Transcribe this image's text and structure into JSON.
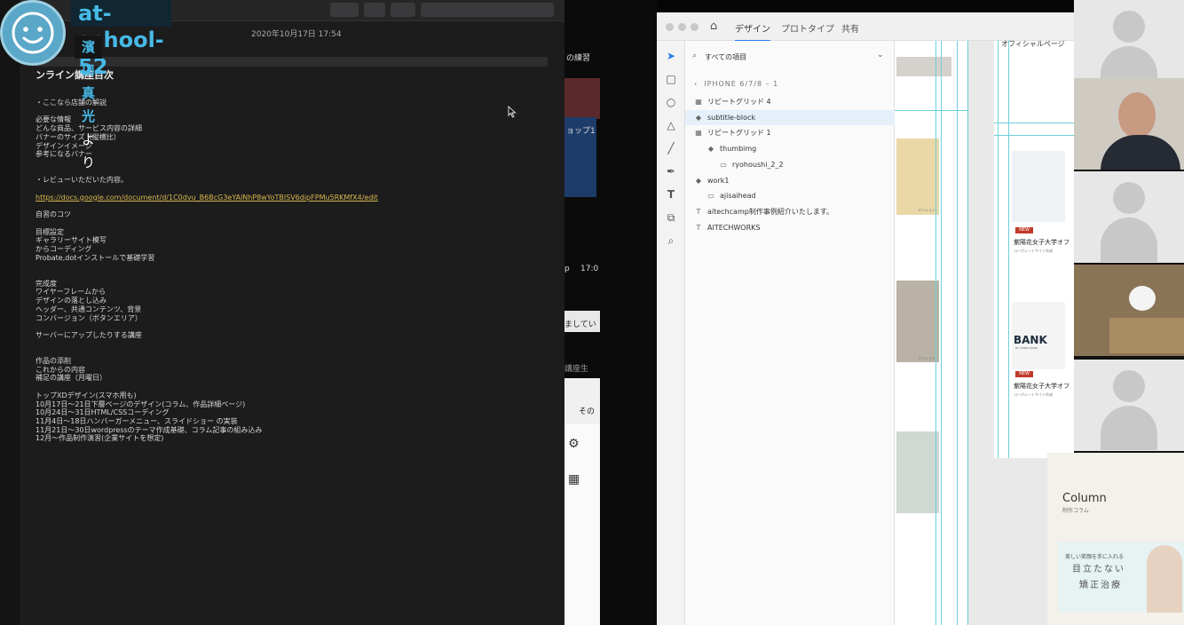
{
  "overlay": {
    "username": "at-school-52",
    "sender_name": "濱口 真光",
    "sender_suffix": "より"
  },
  "note": {
    "timestamp": "2020年10月17日 17:54",
    "heading": "ンライン講座目次",
    "lines": [
      "・ここなら店舗の解説",
      "",
      "必要な情報",
      "どんな商品、サービス内容の詳細",
      "バナーのサイズ（縦横比）",
      "デザインイメージ",
      "参考になるバナー",
      "",
      "",
      "・レビューいただいた内容。",
      "",
      "https://docs.google.com/document/d/1C0dvu_B6BcG3eYAlNhP8wYoTBlSV6dipFPMu5RKMfX4/edit",
      "",
      "自習のコツ",
      "",
      "目標設定",
      "ギャラリーサイト模写",
      "からコーディング",
      "Probate,dotインストールで基礎学習",
      "",
      "",
      "完成度",
      "ワイヤーフレームから",
      "デザインの落とし込み",
      "ヘッダー、共通コンテンツ、背景",
      "コンバージョン（ボタンエリア）",
      "",
      "サーバーにアップしたりする講座",
      "",
      "",
      "作品の添削",
      "これからの内容",
      "補足の講座（月曜日）",
      "",
      "トップXDデザイン(スマホ用も)",
      "10月17日〜21日下層ページのデザイン(コラム、作品詳細ページ)",
      "10月24日〜31日HTML/CSSコーディング",
      "11月4日〜18日ハンバーガーメニュー、スライドショー の実装",
      "11月21日〜30日wordpressのテーマ作成基礎、コラム記事の組み込み",
      "12月〜作品制作演習(企業サイトを想定)"
    ]
  },
  "midgap": {
    "texts": [
      "の練習",
      "ョップ1",
      "17:0",
      "p",
      "ましてい",
      "講座生",
      "その"
    ]
  },
  "xd": {
    "tabs": [
      "デザイン",
      "プロトタイプ",
      "共有"
    ],
    "search_placeholder": "すべての項目",
    "breadcrumb": "IPHONE 6/7/8 – 1",
    "layers": [
      {
        "label": "リピートグリッド 4",
        "icon": "grid-icon",
        "glyph": "▦",
        "indent": 0,
        "selected": false
      },
      {
        "label": "subtitle-block",
        "icon": "component-icon",
        "glyph": "◆",
        "indent": 0,
        "selected": true
      },
      {
        "label": "リピートグリッド 1",
        "icon": "grid-icon",
        "glyph": "▦",
        "indent": 0,
        "selected": false
      },
      {
        "label": "thumbimg",
        "icon": "component-icon",
        "glyph": "◆",
        "indent": 1,
        "selected": false
      },
      {
        "label": "ryohoushi_2_2",
        "icon": "image-icon",
        "glyph": "▭",
        "indent": 2,
        "selected": false
      },
      {
        "label": "work1",
        "icon": "component-icon",
        "glyph": "◆",
        "indent": 0,
        "selected": false
      },
      {
        "label": "ajisaihead",
        "icon": "image-icon",
        "glyph": "▭",
        "indent": 1,
        "selected": false
      },
      {
        "label": "aitechcamp制作事例紹介いたします。",
        "icon": "text-icon",
        "glyph": "T",
        "indent": 0,
        "selected": false
      },
      {
        "label": "AITECHWORKS",
        "icon": "text-icon",
        "glyph": "T",
        "indent": 0,
        "selected": false
      }
    ],
    "canvas": {
      "page_title": "オフィシャルページ",
      "new_badge": "NEW",
      "card_title": "紫陽花女子大学オフ",
      "card_sub": "コーポレートサイト作成",
      "bank_logo": "BANK",
      "bank_sub": "BY ASIBKA BANK",
      "tag1": "マンション",
      "tag2": "マンション"
    }
  },
  "preview": {
    "column_title": "Column",
    "column_sub": "制作コラム",
    "banner_headline": "美しい笑顔を手に入れる",
    "banner_title_1": "目立たない",
    "banner_title_2": "矯正治療"
  }
}
